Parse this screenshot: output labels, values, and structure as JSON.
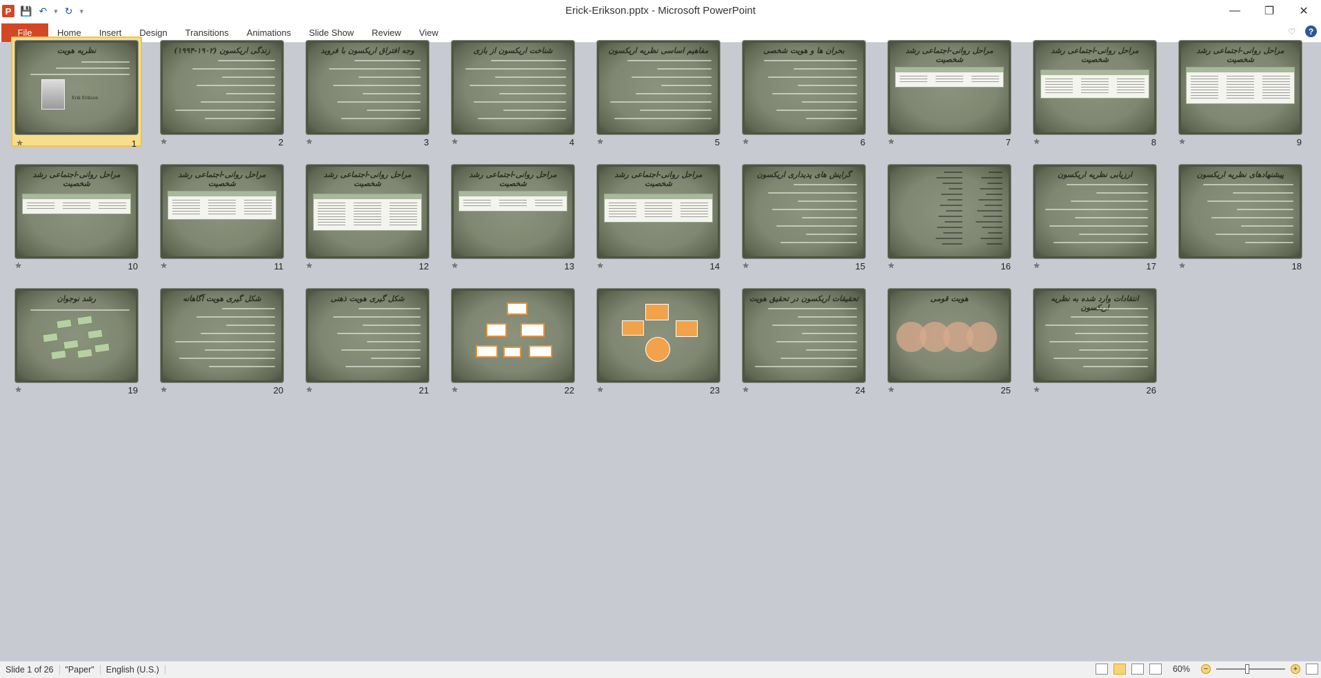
{
  "window": {
    "title": "Erick-Erikson.pptx  -  Microsoft PowerPoint",
    "app_icon": "P"
  },
  "qat": {
    "save_icon": "💾",
    "undo_icon": "↶",
    "redo_icon": "↻",
    "more_icon": "▾"
  },
  "window_controls": {
    "minimize": "—",
    "restore": "❐",
    "close": "✕"
  },
  "ribbon": {
    "file_label": "File",
    "tabs": [
      "Home",
      "Insert",
      "Design",
      "Transitions",
      "Animations",
      "Slide Show",
      "Review",
      "View"
    ],
    "help_label": "?",
    "collapse_icon": "♡"
  },
  "slides": [
    {
      "num": "1",
      "title": "نظریه هویت",
      "kind": "photo",
      "selected": true,
      "photo_caption": "Erik Erikson"
    },
    {
      "num": "2",
      "title": "زندگی اریکسون (۱۹۰۲-۱۹۹۴)",
      "kind": "text"
    },
    {
      "num": "3",
      "title": "وجه افتراق اریکسون با فروید",
      "kind": "text"
    },
    {
      "num": "4",
      "title": "شناخت اریکسون از بازی",
      "kind": "text"
    },
    {
      "num": "5",
      "title": "مفاهیم اساسی نظریه اریکسون",
      "kind": "text"
    },
    {
      "num": "6",
      "title": "بحران ها و هویت شخصی",
      "kind": "text"
    },
    {
      "num": "7",
      "title": "مراحل روانی-اجتماعی رشد شخصیت",
      "kind": "table"
    },
    {
      "num": "8",
      "title": "مراحل روانی-اجتماعی رشد شخصیت",
      "kind": "table"
    },
    {
      "num": "9",
      "title": "مراحل روانی-اجتماعی رشد شخصیت",
      "kind": "table"
    },
    {
      "num": "10",
      "title": "مراحل روانی-اجتماعی رشد شخصیت",
      "kind": "table"
    },
    {
      "num": "11",
      "title": "مراحل روانی-اجتماعی رشد شخصیت",
      "kind": "table"
    },
    {
      "num": "12",
      "title": "مراحل روانی-اجتماعی رشد شخصیت",
      "kind": "table"
    },
    {
      "num": "13",
      "title": "مراحل روانی-اجتماعی رشد شخصیت",
      "kind": "table"
    },
    {
      "num": "14",
      "title": "مراحل روانی-اجتماعی رشد شخصیت",
      "kind": "table"
    },
    {
      "num": "15",
      "title": "گرایش های پدیداری اریکسون",
      "kind": "text"
    },
    {
      "num": "16",
      "title": "",
      "kind": "list"
    },
    {
      "num": "17",
      "title": "ارزیابی نظریه اریکسون",
      "kind": "text"
    },
    {
      "num": "18",
      "title": "پیشنهادهای نظریه اریکسون",
      "kind": "text"
    },
    {
      "num": "19",
      "title": "رشد نوجوان",
      "kind": "blocks"
    },
    {
      "num": "20",
      "title": "شکل گیری هویت آگاهانه",
      "kind": "text"
    },
    {
      "num": "21",
      "title": "شکل گیری هویت ذهنی",
      "kind": "text"
    },
    {
      "num": "22",
      "title": "",
      "kind": "orgchart"
    },
    {
      "num": "23",
      "title": "",
      "kind": "cycle"
    },
    {
      "num": "24",
      "title": "تحقیقات اریکسون در تحقیق هویت",
      "kind": "text"
    },
    {
      "num": "25",
      "title": "هویت قومی",
      "kind": "circles"
    },
    {
      "num": "26",
      "title": "انتقادات وارد شده به نظریه اریکسون",
      "kind": "text"
    }
  ],
  "transition_icon": "✯",
  "status": {
    "slide_info": "Slide 1 of 26",
    "theme": "\"Paper\"",
    "language": "English (U.S.)",
    "zoom": "60%",
    "zoom_minus": "−",
    "zoom_plus": "+"
  }
}
